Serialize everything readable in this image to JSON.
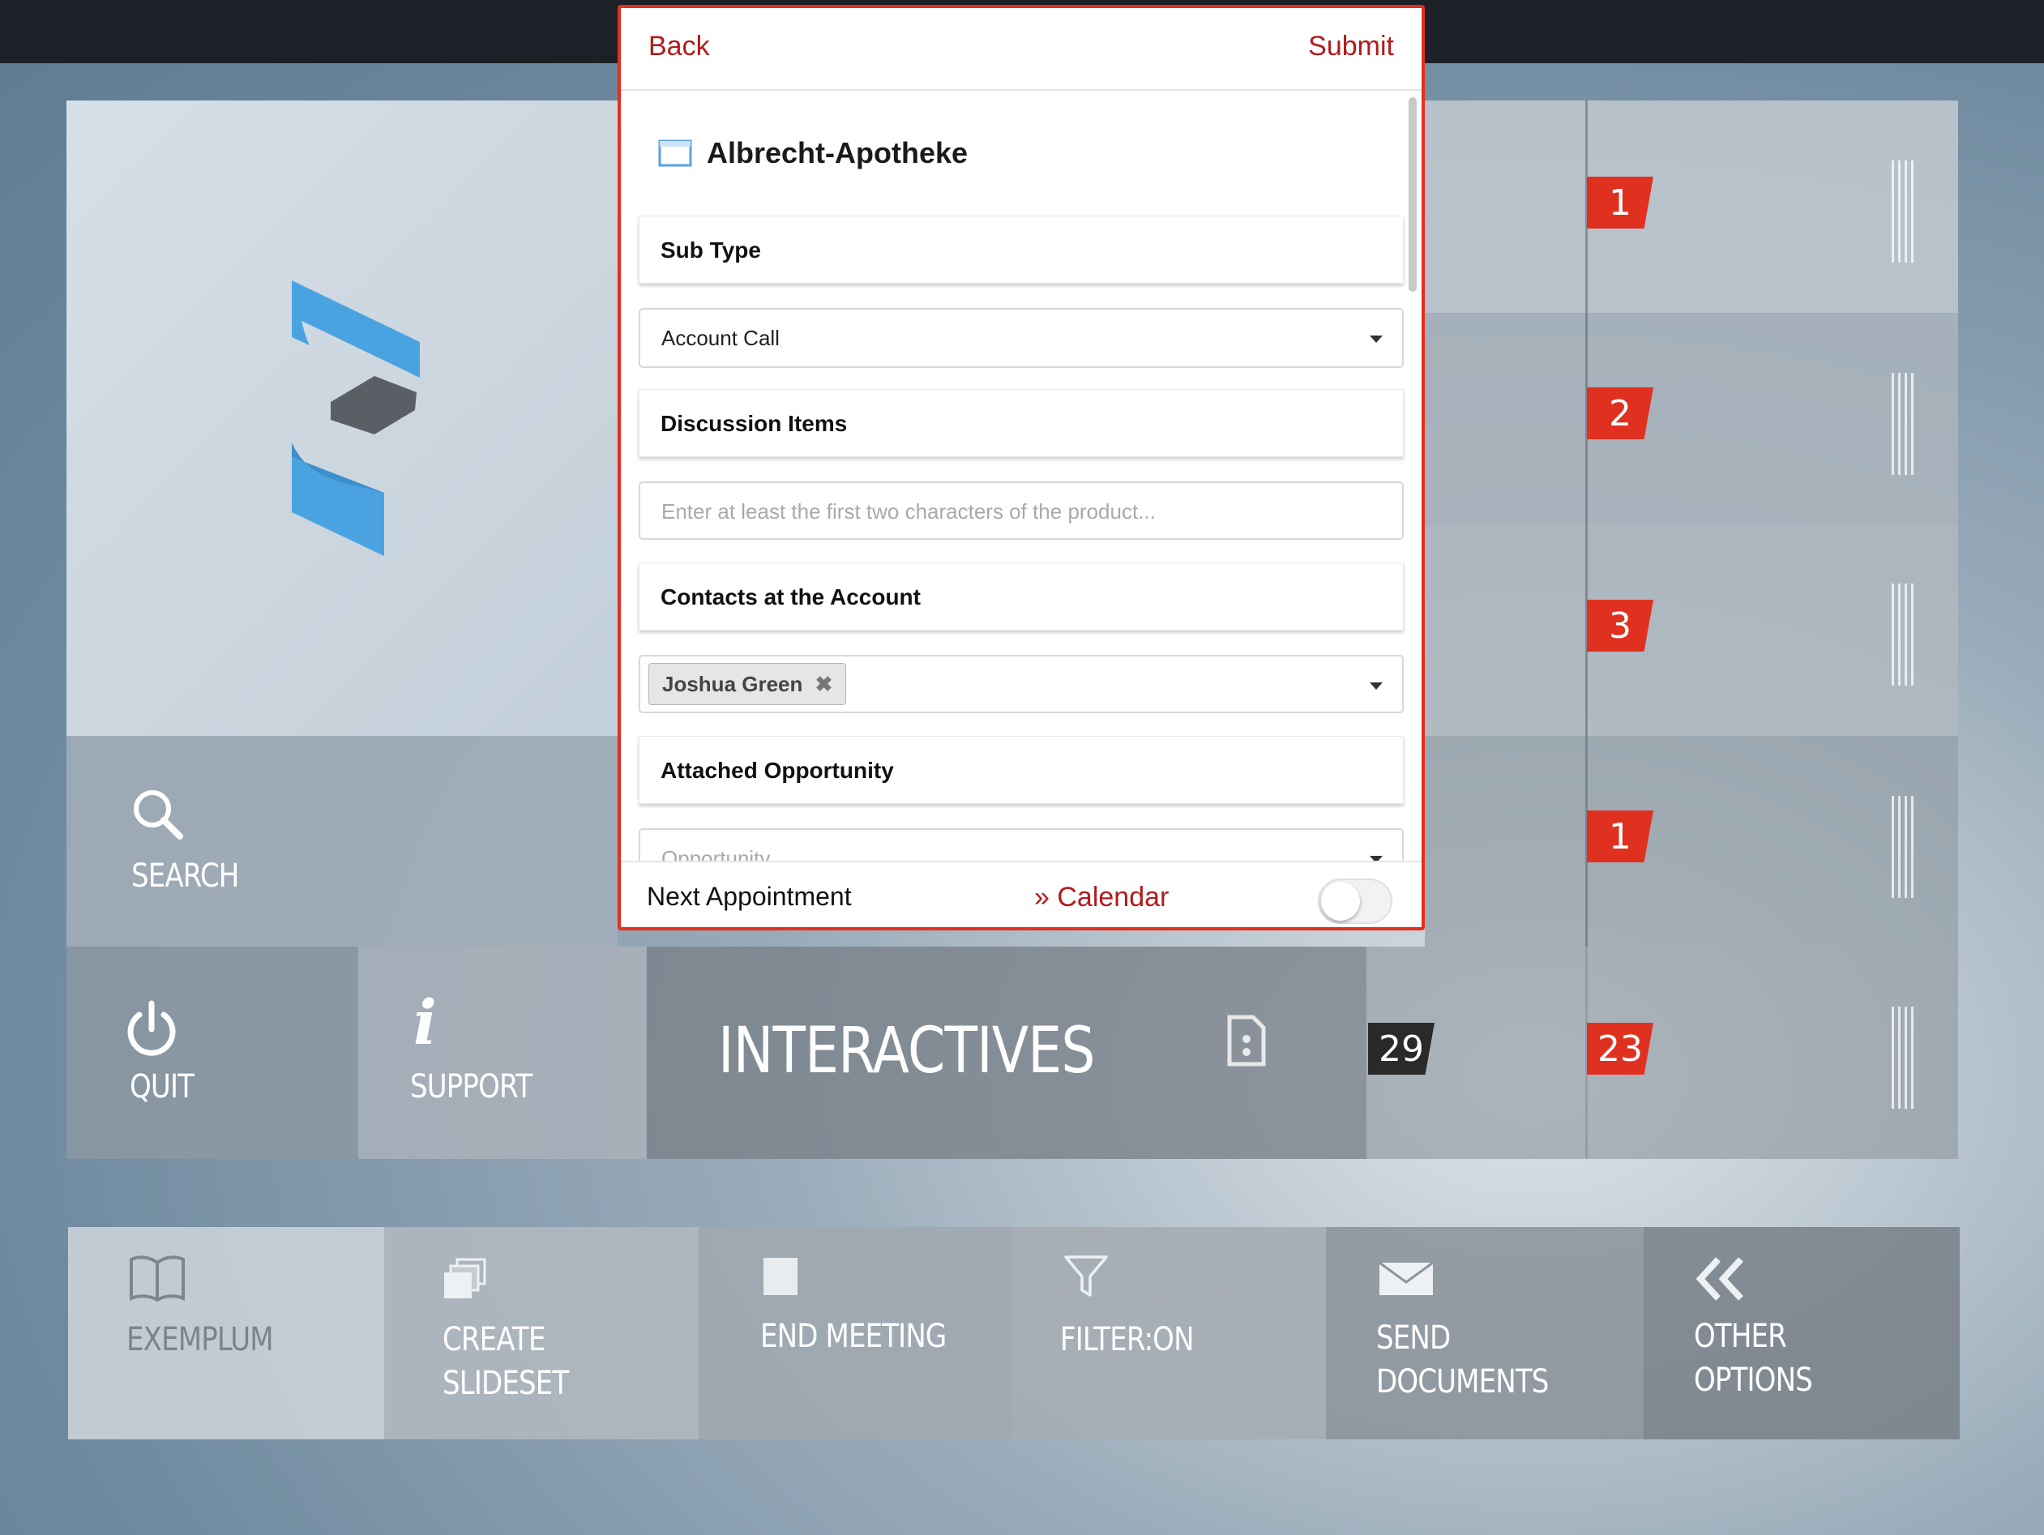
{
  "modal": {
    "back_label": "Back",
    "submit_label": "Submit",
    "account_name": "Albrecht-Apotheke",
    "sections": {
      "sub_type": "Sub Type",
      "discussion_items": "Discussion Items",
      "contacts": "Contacts at the Account",
      "attached_opportunity": "Attached Opportunity"
    },
    "sub_type_value": "Account Call",
    "product_placeholder": "Enter at least the first two characters of the product...",
    "contact_chip": "Joshua Green",
    "opportunity_placeholder": "Opportunity",
    "footer": {
      "next_appointment": "Next Appointment",
      "calendar_link": "» Calendar",
      "toggle_on": false
    }
  },
  "tiles": {
    "search": "SEARCH",
    "quit": "QUIT",
    "support": "SUPPORT",
    "interactives": "INTERACTIVES",
    "interactives_count": "29",
    "interactives_badge": "23"
  },
  "badges": [
    "1",
    "2",
    "3",
    "1"
  ],
  "bottom_bar": {
    "exemplum": "EXEMPLUM",
    "create_slideset_1": "CREATE",
    "create_slideset_2": "SLIDESET",
    "end_meeting": "END MEETING",
    "filter": "FILTER:ON",
    "send_documents_1": "SEND",
    "send_documents_2": "DOCUMENTS",
    "other_options_1": "OTHER",
    "other_options_2": "OPTIONS"
  },
  "colors": {
    "accent_red": "#e0301f",
    "link_red": "#b31b1b",
    "logo_blue": "#4aa3e0",
    "logo_gray": "#5a5f66"
  }
}
